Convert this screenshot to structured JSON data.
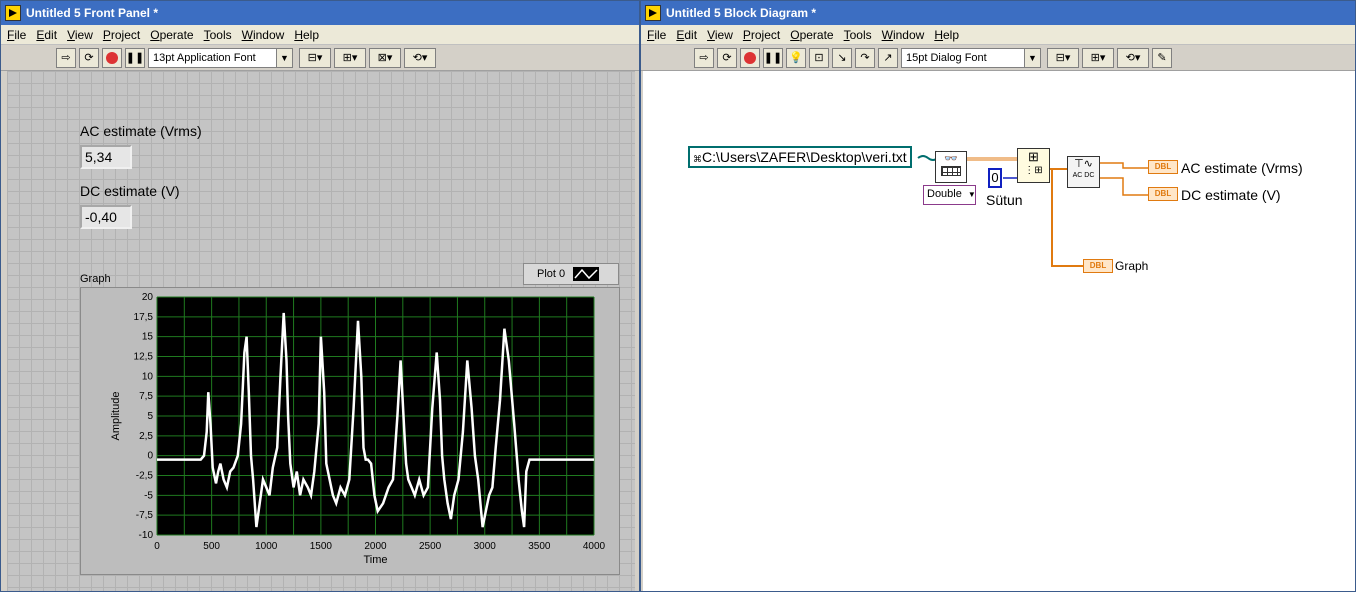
{
  "front_panel": {
    "title": "Untitled 5 Front Panel *",
    "menu": [
      "File",
      "Edit",
      "View",
      "Project",
      "Operate",
      "Tools",
      "Window",
      "Help"
    ],
    "font_selector": "13pt Application Font",
    "ac_label": "AC estimate (Vrms)",
    "ac_value": "5,34",
    "dc_label": "DC estimate (V)",
    "dc_value": "-0,40",
    "graph_label": "Graph",
    "legend_plot": "Plot 0"
  },
  "block_diagram": {
    "title": "Untitled 5 Block Diagram *",
    "menu": [
      "File",
      "Edit",
      "View",
      "Project",
      "Operate",
      "Tools",
      "Window",
      "Help"
    ],
    "font_selector": "15pt Dialog Font",
    "path_constant": "C:\\Users\\ZAFER\\Desktop\\veri.txt",
    "type_selector": "Double",
    "column_constant": "0",
    "column_label": "Sütun",
    "ac_indicator": "AC estimate (Vrms)",
    "dc_indicator": "DC estimate (V)",
    "graph_indicator": "Graph",
    "dbl_tag": "DBL",
    "acdc_tag": "AC DC"
  },
  "chart_data": {
    "type": "line",
    "xlabel": "Time",
    "ylabel": "Amplitude",
    "xlim": [
      0,
      4000
    ],
    "ylim": [
      -10,
      20
    ],
    "x_ticks": [
      "0",
      "500",
      "1000",
      "1500",
      "2000",
      "2500",
      "3000",
      "3500",
      "4000"
    ],
    "y_ticks": [
      "20",
      "17,5",
      "15",
      "12,5",
      "10",
      "7,5",
      "5",
      "2,5",
      "0",
      "-2,5",
      "-5",
      "-7,5",
      "-10"
    ],
    "grid": true,
    "series": [
      {
        "name": "Plot 0",
        "x": [
          0,
          350,
          400,
          430,
          455,
          470,
          490,
          510,
          540,
          560,
          580,
          610,
          640,
          670,
          700,
          740,
          770,
          800,
          820,
          840,
          860,
          880,
          910,
          940,
          970,
          1000,
          1030,
          1060,
          1100,
          1130,
          1160,
          1185,
          1200,
          1220,
          1250,
          1280,
          1310,
          1340,
          1380,
          1410,
          1440,
          1480,
          1500,
          1530,
          1550,
          1580,
          1610,
          1640,
          1680,
          1720,
          1760,
          1800,
          1840,
          1870,
          1890,
          1910,
          1930,
          1960,
          1990,
          2020,
          2070,
          2120,
          2160,
          2200,
          2230,
          2260,
          2280,
          2300,
          2330,
          2360,
          2400,
          2440,
          2480,
          2520,
          2560,
          2590,
          2610,
          2630,
          2660,
          2690,
          2720,
          2760,
          2800,
          2840,
          2880,
          2910,
          2940,
          2960,
          2980,
          3010,
          3040,
          3070,
          3100,
          3140,
          3180,
          3220,
          3270,
          3310,
          3340,
          3360,
          3380,
          3410,
          3450,
          3480,
          3510,
          3540,
          3570,
          3600,
          3650,
          4000
        ],
        "y": [
          -0.5,
          -0.5,
          -0.5,
          0,
          3,
          8,
          4,
          -1.5,
          -3.5,
          -2,
          -1,
          -3,
          -4,
          -2,
          -1.5,
          0,
          4,
          13,
          15,
          8,
          0,
          -3,
          -9,
          -6,
          -3,
          -4,
          -5,
          -1.5,
          1,
          10,
          18,
          12,
          5,
          -1,
          -4,
          -2,
          -5,
          -3,
          -4,
          -5,
          -2,
          4,
          15,
          8,
          -1,
          -3,
          -5,
          -6,
          -4,
          -5,
          -3,
          6,
          17,
          10,
          1,
          -0.5,
          -0.5,
          -1,
          -5,
          -7,
          -6,
          -4,
          -3,
          5,
          12,
          4,
          -1,
          -3,
          -4,
          -5,
          -3,
          -5,
          -4,
          6,
          13,
          7,
          0,
          -3,
          -6,
          -8,
          -5,
          -3,
          3,
          12,
          6,
          0,
          -3,
          -6,
          -9,
          -7,
          -5,
          -4,
          1,
          7,
          16,
          12,
          4,
          -3,
          -7,
          -9,
          -2,
          -0.5,
          -0.5,
          -0.5,
          -0.5,
          -0.5,
          -0.5,
          -0.5,
          -0.5,
          -0.5
        ]
      }
    ]
  }
}
